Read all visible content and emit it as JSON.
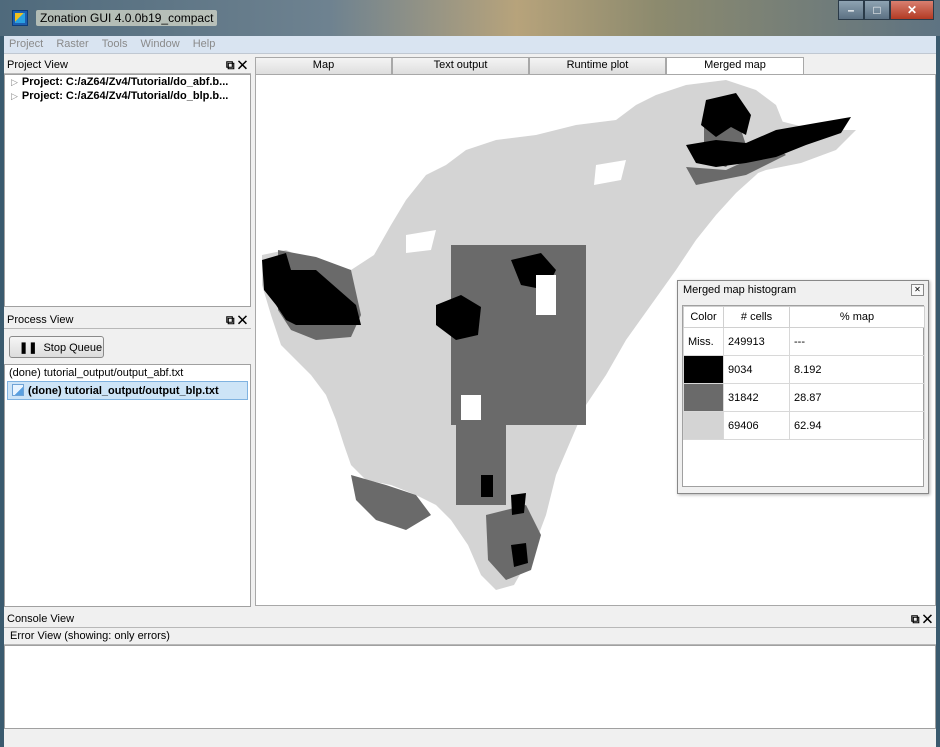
{
  "window": {
    "title": "Zonation GUI 4.0.0b19_compact",
    "controls": [
      "minimize",
      "maximize",
      "close"
    ]
  },
  "menu": [
    "Project",
    "Raster",
    "Tools",
    "Window",
    "Help"
  ],
  "project_view": {
    "title": "Project View",
    "items": [
      "Project: C:/aZ64/Zv4/Tutorial/do_abf.b...",
      "Project: C:/aZ64/Zv4/Tutorial/do_blp.b..."
    ]
  },
  "process_view": {
    "title": "Process View",
    "stop_button": "Stop Queue",
    "items": [
      "(done) tutorial_output/output_abf.txt",
      "(done) tutorial_output/output_blp.txt"
    ]
  },
  "tabs": [
    "Map",
    "Text output",
    "Runtime plot",
    "Merged map"
  ],
  "active_tab": "Merged map",
  "histogram": {
    "title": "Merged map histogram",
    "columns": [
      "Color",
      "# cells",
      "% map"
    ],
    "rows": [
      {
        "color_label": "Miss.",
        "cells": "249913",
        "pct": "---",
        "swatch": ""
      },
      {
        "color_label": "",
        "cells": "9034",
        "pct": "8.192",
        "swatch": "#000000"
      },
      {
        "color_label": "",
        "cells": "31842",
        "pct": "28.87",
        "swatch": "#6a6a6a"
      },
      {
        "color_label": "",
        "cells": "69406",
        "pct": "62.94",
        "swatch": "#d4d4d4"
      }
    ]
  },
  "console_view": {
    "title": "Console View",
    "subtitle": "Error View (showing: only errors)"
  },
  "colors": {
    "black_class": "#000000",
    "dark_class": "#6a6a6a",
    "light_class": "#d4d4d4"
  }
}
